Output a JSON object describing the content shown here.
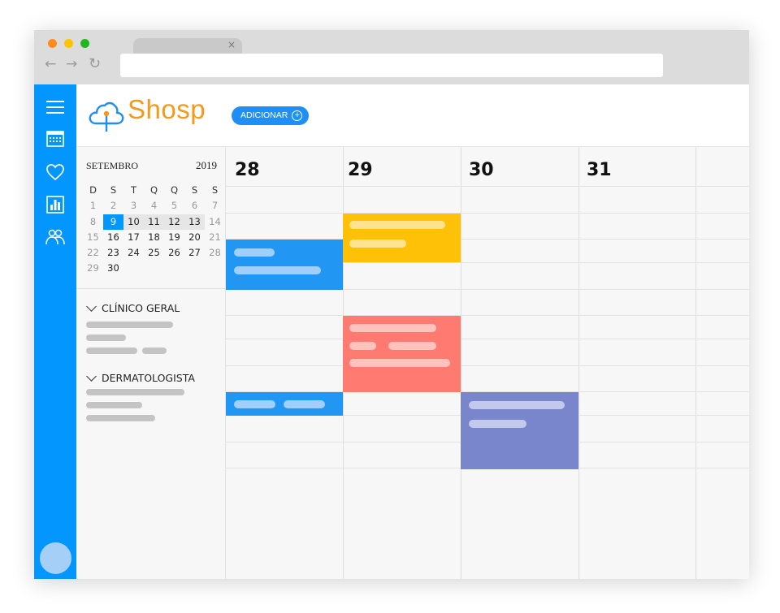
{
  "app": {
    "name": "Shosp",
    "add_label": "ADICIONAR"
  },
  "browser": {
    "tab_close": "×",
    "back": "←",
    "forward": "→",
    "reload": "↻"
  },
  "colors": {
    "brand_blue": "#0396ff",
    "logo_orange": "#f39a1c",
    "event_blue": "#2196f3",
    "event_yellow": "#ffc107",
    "event_red": "#ff7b72",
    "event_purple": "#7986cb"
  },
  "sidebar": {
    "icons": [
      "menu-icon",
      "calendar-icon",
      "heart-icon",
      "chart-icon",
      "doctors-icon"
    ],
    "avatar": "avatar"
  },
  "mini_calendar": {
    "month": "SETEMBRO",
    "year": "2019",
    "weekdays": [
      "D",
      "S",
      "T",
      "Q",
      "Q",
      "S",
      "S"
    ],
    "weeks": [
      [
        "1",
        "2",
        "3",
        "4",
        "5",
        "6",
        "7"
      ],
      [
        "8",
        "9",
        "10",
        "11",
        "12",
        "13",
        "14"
      ],
      [
        "15",
        "16",
        "17",
        "18",
        "19",
        "20",
        "21"
      ],
      [
        "22",
        "23",
        "24",
        "25",
        "26",
        "27",
        "28"
      ],
      [
        "29",
        "30",
        "",
        "",
        "",
        "",
        ""
      ]
    ],
    "selected_day": "9"
  },
  "groups": [
    {
      "title": "CLÍNICO GERAL"
    },
    {
      "title": "DERMATOLOGISTA"
    }
  ],
  "days": [
    "28",
    "29",
    "30",
    "31",
    ""
  ]
}
